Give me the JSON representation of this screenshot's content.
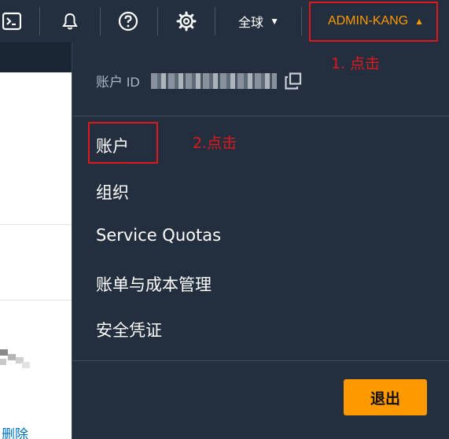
{
  "topbar": {
    "region_label": "全球",
    "account_label": "ADMIN-KANG",
    "icons": [
      "cloudshell-icon",
      "bell-icon",
      "help-icon",
      "gear-icon"
    ]
  },
  "menu": {
    "account_id_label": "账户 ID",
    "items": [
      {
        "label": "账户"
      },
      {
        "label": "组织"
      },
      {
        "label": "Service Quotas"
      },
      {
        "label": "账单与成本管理"
      },
      {
        "label": "安全凭证"
      }
    ],
    "logout_label": "退出"
  },
  "page": {
    "delete_link": "删除"
  },
  "annotations": {
    "step1": "1. 点击",
    "step2": "2.点击",
    "color": "#e0181b"
  },
  "colors": {
    "nav_bg": "#232f3e",
    "accent": "#ff9900",
    "link": "#0073bb"
  }
}
